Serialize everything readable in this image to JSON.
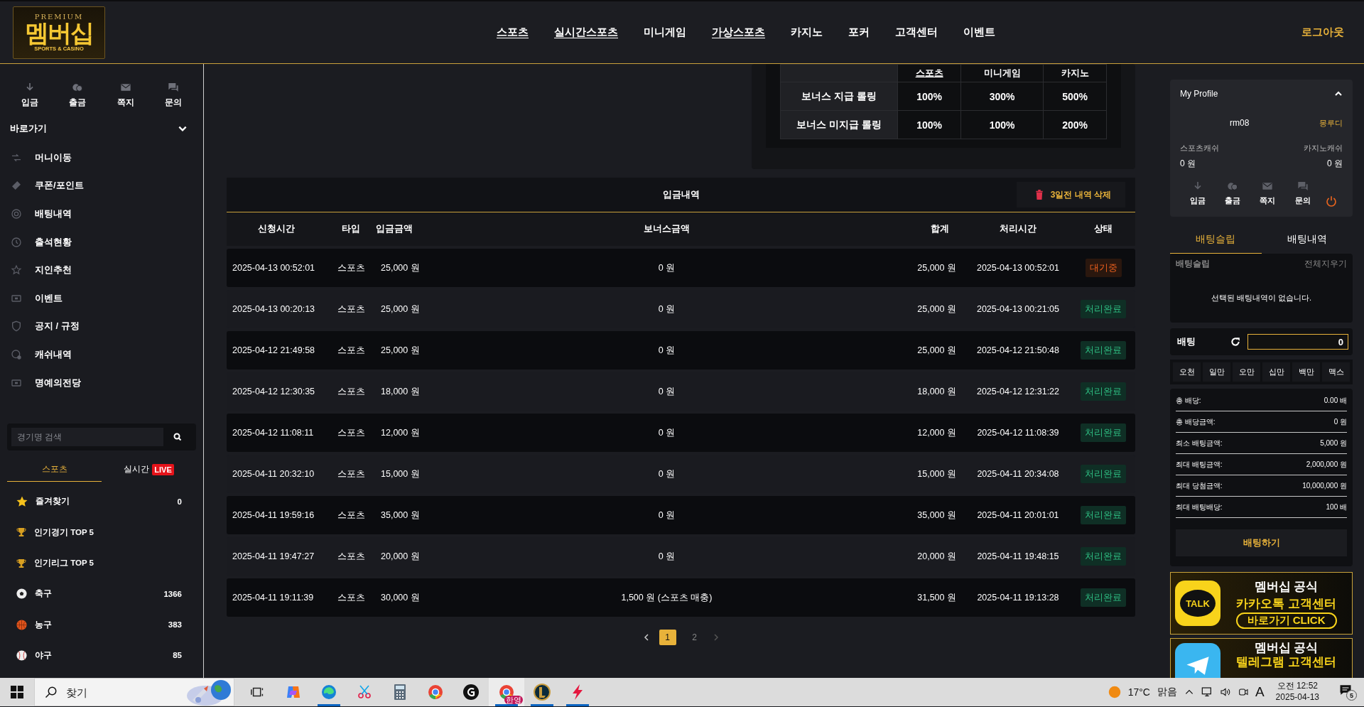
{
  "header": {
    "logo": {
      "top": "PREMIUM",
      "main": "멤버십",
      "bottom": "SPORTS & CASINO"
    },
    "nav": [
      {
        "label": "스포츠",
        "underlined": true
      },
      {
        "label": "실시간스포츠",
        "underlined": true
      },
      {
        "label": "미니게임",
        "underlined": false
      },
      {
        "label": "가상스포츠",
        "underlined": true
      },
      {
        "label": "카지노",
        "underlined": false
      },
      {
        "label": "포커",
        "underlined": false
      },
      {
        "label": "고객센터",
        "underlined": false
      },
      {
        "label": "이벤트",
        "underlined": false
      }
    ],
    "logout": "로그아웃"
  },
  "sidebar": {
    "quick": [
      "입금",
      "출금",
      "쪽지",
      "문의"
    ],
    "shortcuts_title": "바로가기",
    "shortcuts_expanded": true,
    "shortcuts": [
      "머니이동",
      "쿠폰/포인트",
      "배팅내역",
      "출석현황",
      "지인추천",
      "이벤트",
      "공지 / 규정",
      "캐쉬내역",
      "명예의전당"
    ],
    "search": {
      "placeholder": "경기명 검색"
    },
    "tabs": [
      {
        "label": "스포츠",
        "selected": true
      },
      {
        "label": "실시간",
        "selected": false,
        "badge": "LIVE"
      }
    ],
    "sports": [
      {
        "name": "즐겨찾기",
        "count": "0"
      },
      {
        "name": "인기경기 TOP 5"
      },
      {
        "name": "인기리그 TOP 5"
      },
      {
        "name": "축구",
        "count": "1366"
      },
      {
        "name": "농구",
        "count": "383"
      },
      {
        "name": "야구",
        "count": "85"
      }
    ]
  },
  "bonus_table": {
    "columns": [
      "",
      "스포츠",
      "미니게임",
      "카지노"
    ],
    "rows": [
      [
        "보너스 지급 롤링",
        "100%",
        "300%",
        "500%"
      ],
      [
        "보너스 미지급 롤링",
        "100%",
        "100%",
        "200%"
      ]
    ]
  },
  "deposits": {
    "title": "입금내역",
    "delete_button": "3일전 내역 삭제",
    "columns": [
      "신청시간",
      "타입",
      "입금금액",
      "보너스금액",
      "합계",
      "처리시간",
      "상태"
    ],
    "rows": [
      {
        "cells": [
          "2025-04-13 00:52:01",
          "스포츠",
          "25,000 원",
          "0 원",
          "25,000 원",
          "2025-04-13 00:52:01"
        ],
        "status": "대기중",
        "kind": "pending"
      },
      {
        "cells": [
          "2025-04-13 00:20:13",
          "스포츠",
          "25,000 원",
          "0 원",
          "25,000 원",
          "2025-04-13 00:21:05"
        ],
        "status": "처리완료",
        "kind": "done"
      },
      {
        "cells": [
          "2025-04-12 21:49:58",
          "스포츠",
          "25,000 원",
          "0 원",
          "25,000 원",
          "2025-04-12 21:50:48"
        ],
        "status": "처리완료",
        "kind": "done"
      },
      {
        "cells": [
          "2025-04-12 12:30:35",
          "스포츠",
          "18,000 원",
          "0 원",
          "18,000 원",
          "2025-04-12 12:31:22"
        ],
        "status": "처리완료",
        "kind": "done"
      },
      {
        "cells": [
          "2025-04-12 11:08:11",
          "스포츠",
          "12,000 원",
          "0 원",
          "12,000 원",
          "2025-04-12 11:08:39"
        ],
        "status": "처리완료",
        "kind": "done"
      },
      {
        "cells": [
          "2025-04-11 20:32:10",
          "스포츠",
          "15,000 원",
          "0 원",
          "15,000 원",
          "2025-04-11 20:34:08"
        ],
        "status": "처리완료",
        "kind": "done"
      },
      {
        "cells": [
          "2025-04-11 19:59:16",
          "스포츠",
          "35,000 원",
          "0 원",
          "35,000 원",
          "2025-04-11 20:01:01"
        ],
        "status": "처리완료",
        "kind": "done"
      },
      {
        "cells": [
          "2025-04-11 19:47:27",
          "스포츠",
          "20,000 원",
          "0 원",
          "20,000 원",
          "2025-04-11 19:48:15"
        ],
        "status": "처리완료",
        "kind": "done"
      },
      {
        "cells": [
          "2025-04-11 19:11:39",
          "스포츠",
          "30,000 원",
          "1,500 원 (스포츠 매충)",
          "31,500 원",
          "2025-04-11 19:13:28"
        ],
        "status": "처리완료",
        "kind": "done"
      }
    ],
    "pages": [
      {
        "label": "1",
        "selected": true
      },
      {
        "label": "2",
        "selected": false
      }
    ]
  },
  "profile": {
    "title": "My Profile",
    "expanded": true,
    "username": "rm08",
    "level": "몽루디",
    "balances": [
      {
        "label": "스포츠캐쉬",
        "value": "0 원"
      },
      {
        "label": "카지노캐쉬",
        "value": "0 원"
      }
    ],
    "actions": [
      "입금",
      "출금",
      "쪽지",
      "문의"
    ]
  },
  "bet_tabs": [
    {
      "label": "배팅슬립",
      "selected": true
    },
    {
      "label": "배팅내역",
      "selected": false
    }
  ],
  "slip": {
    "title": "배팅슬립",
    "clear": "전체지우기",
    "empty": "선택된 배팅내역이 없습니다."
  },
  "bet": {
    "label": "배팅",
    "amount": "0",
    "quick": [
      "오천",
      "일만",
      "오만",
      "십만",
      "백만",
      "맥스"
    ],
    "summary": [
      {
        "label": "총 배당:",
        "value": "0.00 배"
      },
      {
        "label": "총 배당금액:",
        "value": "0 원"
      },
      {
        "label": "최소 배팅금액:",
        "value": "5,000 원"
      },
      {
        "label": "최대 배팅금액:",
        "value": "2,000,000 원"
      },
      {
        "label": "최대 당첨금액:",
        "value": "10,000,000 원"
      },
      {
        "label": "최대 배팅배당:",
        "value": "100 배"
      }
    ],
    "submit": "배팅하기"
  },
  "banners": [
    {
      "kind": "kakao",
      "badge": "TALK",
      "lines": [
        "멤버십 공식",
        "카카오톡 고객센터",
        "바로가기 CLICK"
      ]
    },
    {
      "kind": "telegram",
      "lines": [
        "멤버십 공식",
        "텔레그램 고객센터"
      ]
    }
  ],
  "taskbar": {
    "search": {
      "placeholder": "찾기"
    },
    "apps": [
      {
        "running": false,
        "selected": false
      },
      {
        "running": false,
        "selected": false
      },
      {
        "running": true,
        "selected": false
      },
      {
        "running": false,
        "selected": false
      },
      {
        "running": false,
        "selected": false
      },
      {
        "running": false,
        "selected": false
      },
      {
        "running": false,
        "selected": false
      },
      {
        "running": true,
        "selected": true,
        "badge": "한영"
      },
      {
        "running": true,
        "selected": false
      },
      {
        "running": true,
        "selected": false
      }
    ],
    "weather": {
      "temp": "17°C",
      "text": "맑음"
    },
    "ime": "A",
    "time": "오전 12:52",
    "date": "2025-04-13",
    "notifications": "5"
  }
}
